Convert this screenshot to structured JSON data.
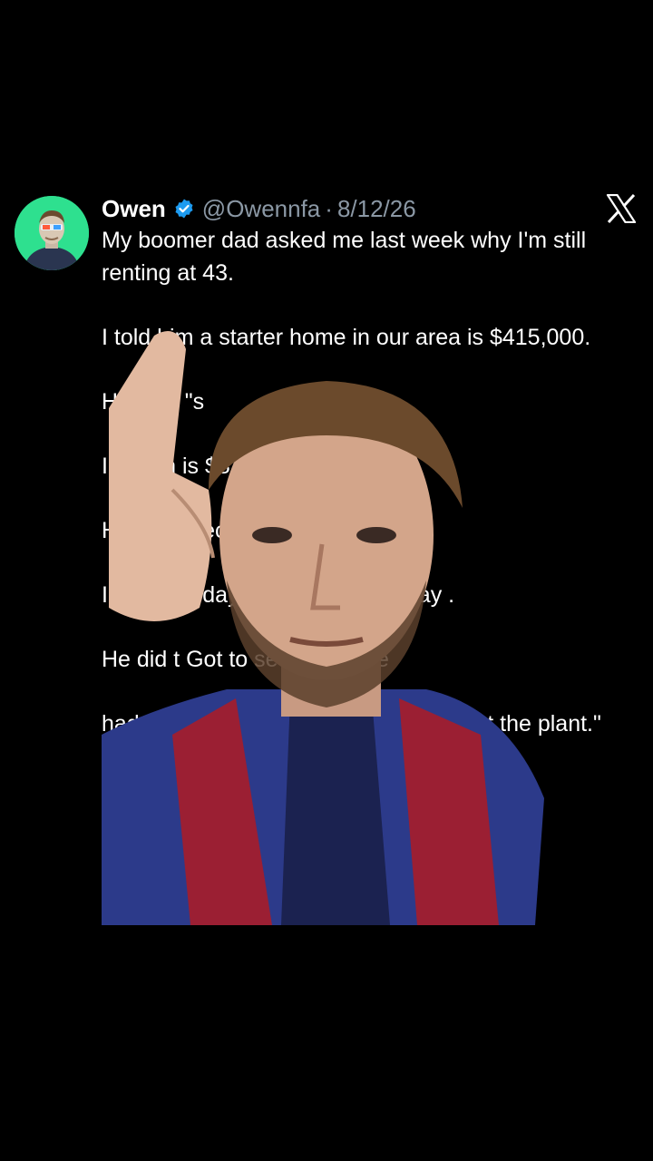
{
  "tweet": {
    "display_name": "Owen",
    "handle": "@Owennfa",
    "separator": "·",
    "date": "8/12/26",
    "paragraphs": [
      "My boomer dad asked me last week why I'm still renting at 43.",
      "I told him a starter home in our area is $415,000.",
      "He said \"s",
      "I told th is $82,000.",
      "H it into pieces.\"",
      "I afte and daycare I put away may .",
      "He did t Got to seventeen ye",
      "had it saved in eight months working at the plant.\""
    ]
  },
  "icons": {
    "verified": "verified-badge-icon",
    "platform": "x-logo-icon",
    "avatar": "profile-avatar"
  },
  "colors": {
    "background": "#000000",
    "text": "#ffffff",
    "muted": "#8b98a5",
    "verified": "#1d9bf0",
    "avatar_bg": "#2ee08f"
  }
}
